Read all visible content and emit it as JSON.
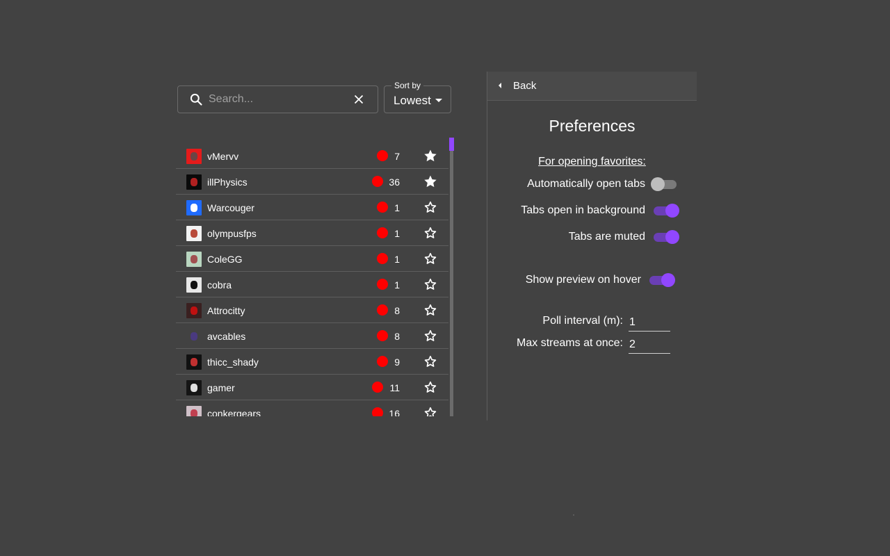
{
  "search": {
    "placeholder": "Search...",
    "value": ""
  },
  "sort": {
    "label": "Sort by",
    "value": "Lowest"
  },
  "accent_color": "#9147ff",
  "live_color": "#ff0000",
  "streams": [
    {
      "name": "vMervv",
      "viewers": "7",
      "favorite": true,
      "avatar_colors": [
        "#e51b1b",
        "#6b4444"
      ]
    },
    {
      "name": "illPhysics",
      "viewers": "36",
      "favorite": true,
      "avatar_colors": [
        "#0a0a0a",
        "#b02020"
      ]
    },
    {
      "name": "Warcouger",
      "viewers": "1",
      "favorite": false,
      "avatar_colors": [
        "#1f6bff",
        "#ffffff"
      ]
    },
    {
      "name": "olympusfps",
      "viewers": "1",
      "favorite": false,
      "avatar_colors": [
        "#f2f2f2",
        "#b84a3a"
      ]
    },
    {
      "name": "ColeGG",
      "viewers": "1",
      "favorite": false,
      "avatar_colors": [
        "#b9d6c0",
        "#a05050"
      ]
    },
    {
      "name": "cobra",
      "viewers": "1",
      "favorite": false,
      "avatar_colors": [
        "#e8e8e8",
        "#111111"
      ]
    },
    {
      "name": "Attrocitty",
      "viewers": "8",
      "favorite": false,
      "avatar_colors": [
        "#3a2020",
        "#c01010"
      ]
    },
    {
      "name": "avcables",
      "viewers": "8",
      "favorite": false,
      "avatar_colors": [
        "#424242",
        "#4a3a80"
      ]
    },
    {
      "name": "thicc_shady",
      "viewers": "9",
      "favorite": false,
      "avatar_colors": [
        "#111111",
        "#c03030"
      ]
    },
    {
      "name": "gamer",
      "viewers": "11",
      "favorite": false,
      "avatar_colors": [
        "#151515",
        "#e0e0e0"
      ]
    },
    {
      "name": "conkergears",
      "viewers": "16",
      "favorite": false,
      "avatar_colors": [
        "#d0c0c8",
        "#c04050"
      ]
    }
  ],
  "preferences": {
    "back_label": "Back",
    "title": "Preferences",
    "section_label": "For opening favorites:",
    "toggles": [
      {
        "label": "Automatically open tabs",
        "on": false
      },
      {
        "label": "Tabs open in background",
        "on": true
      },
      {
        "label": "Tabs are muted",
        "on": true
      },
      {
        "label": "Show preview on hover",
        "on": true
      }
    ],
    "poll_interval": {
      "label": "Poll interval (m):",
      "value": "1"
    },
    "max_streams": {
      "label": "Max streams at once:",
      "value": "2"
    }
  }
}
